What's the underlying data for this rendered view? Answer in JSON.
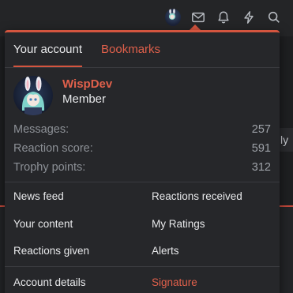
{
  "header": {
    "icons": [
      {
        "name": "user-avatar-icon"
      },
      {
        "name": "envelope-icon"
      },
      {
        "name": "bell-icon"
      },
      {
        "name": "lightning-icon"
      },
      {
        "name": "search-icon"
      }
    ]
  },
  "background": {
    "peek_text": "ly"
  },
  "popup": {
    "tabs": [
      {
        "label": "Your account",
        "active": true
      },
      {
        "label": "Bookmarks",
        "active": false
      }
    ],
    "user": {
      "name": "WispDev",
      "title": "Member"
    },
    "stats": [
      {
        "label": "Messages:",
        "value": "257"
      },
      {
        "label": "Reaction score:",
        "value": "591"
      },
      {
        "label": "Trophy points:",
        "value": "312"
      }
    ],
    "links": {
      "news_feed": "News feed",
      "reactions_received": "Reactions received",
      "your_content": "Your content",
      "my_ratings": "My Ratings",
      "reactions_given": "Reactions given",
      "alerts": "Alerts",
      "account_details": "Account details",
      "signature": "Signature"
    }
  },
  "colors": {
    "accent": "#e0604b",
    "popup_bg": "#26272a",
    "text": "#e8e9eb",
    "muted": "#8c9096"
  }
}
